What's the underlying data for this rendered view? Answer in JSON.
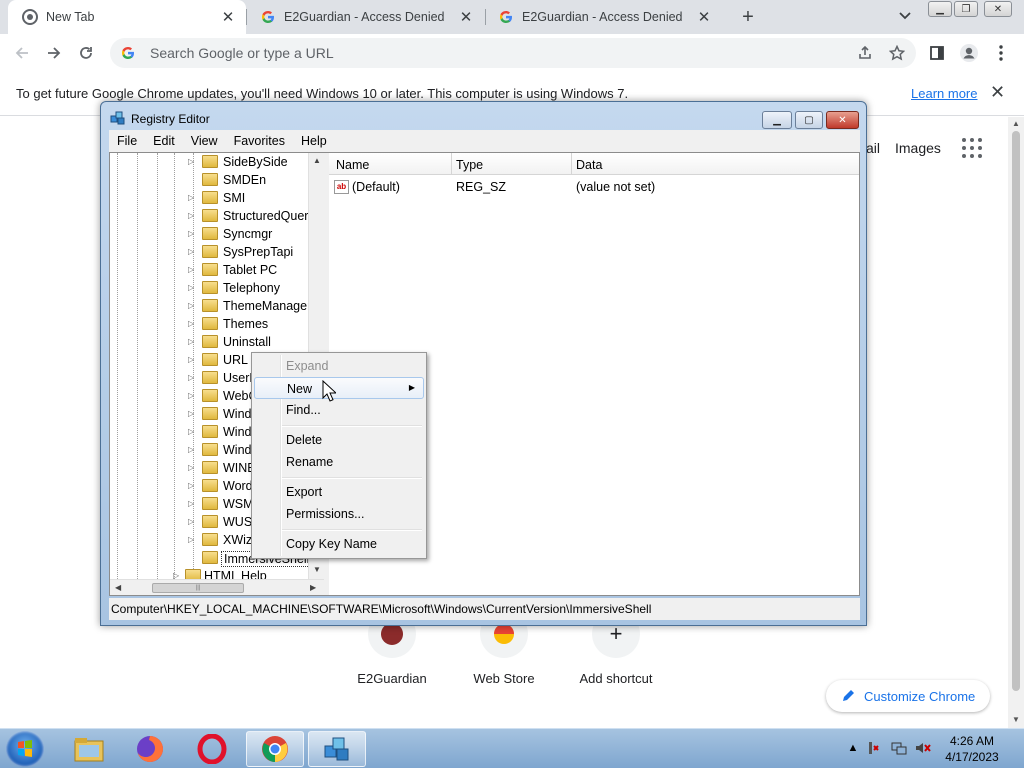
{
  "browser": {
    "tabs": [
      {
        "title": "New Tab",
        "active": true
      },
      {
        "title": "E2Guardian - Access Denied",
        "active": false
      },
      {
        "title": "E2Guardian - Access Denied",
        "active": false
      }
    ],
    "omnibox_placeholder": "Search Google or type a URL",
    "infobar": {
      "message": "To get future Google Chrome updates, you'll need Windows 10 or later. This computer is using Windows 7.",
      "link": "Learn more"
    },
    "ntp": {
      "top_links": [
        "ail",
        "Images"
      ],
      "shortcuts": [
        {
          "label": "E2Guardian"
        },
        {
          "label": "Web Store"
        },
        {
          "label": "Add shortcut"
        }
      ],
      "customize_label": "Customize Chrome"
    }
  },
  "regedit": {
    "title": "Registry Editor",
    "menu": [
      "File",
      "Edit",
      "View",
      "Favorites",
      "Help"
    ],
    "tree": [
      {
        "name": "SideBySide",
        "expandable": true
      },
      {
        "name": "SMDEn",
        "expandable": false
      },
      {
        "name": "SMI",
        "expandable": true
      },
      {
        "name": "StructuredQuery",
        "expandable": true
      },
      {
        "name": "Syncmgr",
        "expandable": true
      },
      {
        "name": "SysPrepTapi",
        "expandable": true
      },
      {
        "name": "Tablet PC",
        "expandable": true
      },
      {
        "name": "Telephony",
        "expandable": true
      },
      {
        "name": "ThemeManager",
        "expandable": true
      },
      {
        "name": "Themes",
        "expandable": true
      },
      {
        "name": "Uninstall",
        "expandable": true
      },
      {
        "name": "URL",
        "expandable": true
      },
      {
        "name": "UserP",
        "expandable": true
      },
      {
        "name": "WebC",
        "expandable": true
      },
      {
        "name": "Wind",
        "expandable": true
      },
      {
        "name": "Wind",
        "expandable": true
      },
      {
        "name": "Wind",
        "expandable": true
      },
      {
        "name": "WINE",
        "expandable": true
      },
      {
        "name": "Word",
        "expandable": true
      },
      {
        "name": "WSM",
        "expandable": true
      },
      {
        "name": "WUSA",
        "expandable": true
      },
      {
        "name": "XWiza",
        "expandable": true
      },
      {
        "name": "ImmersiveShell",
        "expandable": false,
        "selected": true
      },
      {
        "name": "HTML Help",
        "expandable": false,
        "level0": true
      }
    ],
    "columns": [
      "Name",
      "Type",
      "Data"
    ],
    "values": [
      {
        "name": "(Default)",
        "type": "REG_SZ",
        "data": "(value not set)"
      }
    ],
    "status_path": "Computer\\HKEY_LOCAL_MACHINE\\SOFTWARE\\Microsoft\\Windows\\CurrentVersion\\ImmersiveShell"
  },
  "context_menu": {
    "items": [
      {
        "label": "Expand",
        "disabled": true
      },
      {
        "label": "New",
        "submenu": true,
        "hover": true
      },
      {
        "label": "Find..."
      },
      {
        "label": "Delete"
      },
      {
        "label": "Rename"
      },
      {
        "label": "Export"
      },
      {
        "label": "Permissions..."
      },
      {
        "label": "Copy Key Name"
      }
    ]
  },
  "taskbar": {
    "time": "4:26 AM",
    "date": "4/17/2023"
  }
}
